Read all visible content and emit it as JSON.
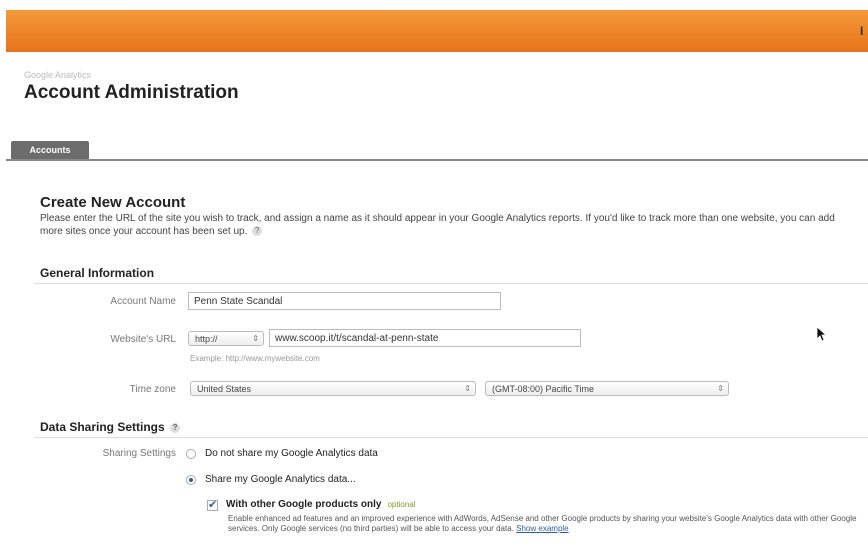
{
  "header": {
    "corner_text": "I"
  },
  "breadcrumb": "Google Analytics",
  "page_title": "Account Administration",
  "tabs": [
    {
      "label": "Accounts"
    }
  ],
  "create": {
    "title": "Create New Account",
    "description": "Please enter the URL of the site you wish to track, and assign a name as it should appear in your Google Analytics reports. If you'd like to track more than one website, you can add more sites once your account has been set up.",
    "help_glyph": "?"
  },
  "general": {
    "heading": "General Information",
    "account_name_label": "Account Name",
    "account_name_value": "Penn State Scandal",
    "website_url_label": "Website's URL",
    "protocol_value": "http://",
    "url_value": "www.scoop.it/t/scandal-at-penn-state",
    "url_example": "Example: http://www.mywebsite.com",
    "time_zone_label": "Time zone",
    "country_value": "United States",
    "tz_value": "(GMT-08:00) Pacific Time"
  },
  "sharing": {
    "heading": "Data Sharing Settings",
    "help_glyph": "?",
    "label": "Sharing Settings",
    "option_no": "Do not share my Google Analytics data",
    "option_yes": "Share my Google Analytics data...",
    "selected": "option_yes",
    "sub_option_label": "With other Google products only",
    "sub_option_tag": "optional",
    "sub_option_checked": true,
    "sub_option_desc": "Enable enhanced ad features and an improved experience with AdWords, AdSense and other Google products by sharing your website's Google Analytics data with other Google services. Only Google services (no third parties) will be able to access your data.",
    "show_example_link": "Show example"
  },
  "icons": {
    "select_arrow": "up-down-arrows-icon",
    "cursor": "mouse-pointer-icon"
  },
  "colors": {
    "topbar": "#e8731a",
    "tab": "#6c6c6c",
    "link": "#2a5db0"
  }
}
